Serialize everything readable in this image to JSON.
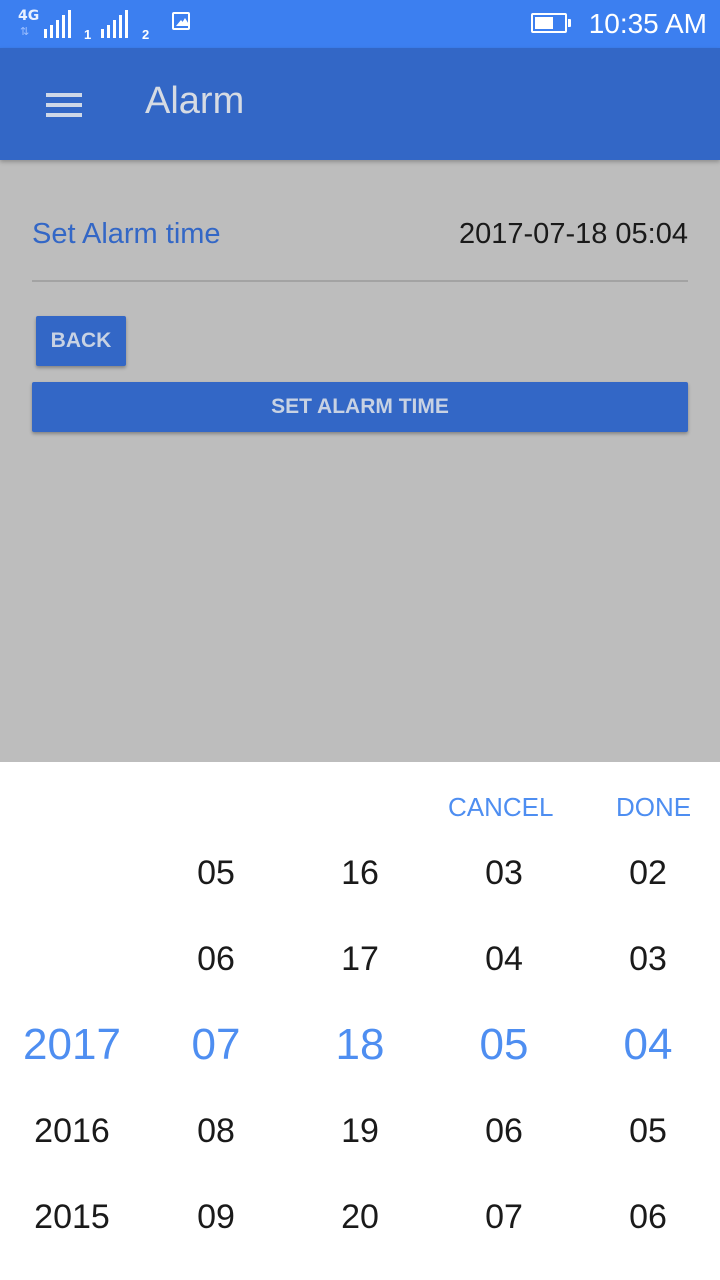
{
  "status_bar": {
    "network": "4G",
    "sim1": "1",
    "sim2": "2",
    "time": "10:35 AM"
  },
  "app_bar": {
    "title": "Alarm",
    "menu_icon": "hamburger-menu-icon"
  },
  "content": {
    "alarm_label": "Set Alarm time",
    "alarm_value": "2017-07-18 05:04",
    "back_button": "BACK",
    "set_button": "SET ALARM TIME"
  },
  "picker": {
    "cancel": "CANCEL",
    "done": "DONE",
    "accent_color": "#4e8ef1",
    "columns": [
      {
        "name": "year",
        "rows": [
          "",
          "",
          "2017",
          "2016",
          "2015"
        ],
        "selected": "2017"
      },
      {
        "name": "month",
        "rows": [
          "05",
          "06",
          "07",
          "08",
          "09"
        ],
        "selected": "07"
      },
      {
        "name": "day",
        "rows": [
          "16",
          "17",
          "18",
          "19",
          "20"
        ],
        "selected": "18"
      },
      {
        "name": "hour",
        "rows": [
          "03",
          "04",
          "05",
          "06",
          "07"
        ],
        "selected": "05"
      },
      {
        "name": "minute",
        "rows": [
          "02",
          "03",
          "04",
          "05",
          "06"
        ],
        "selected": "04"
      }
    ]
  },
  "colors": {
    "status_bar": "#3c7ff0",
    "app_bar": "#3367c6",
    "background": "#bdbdbd"
  }
}
